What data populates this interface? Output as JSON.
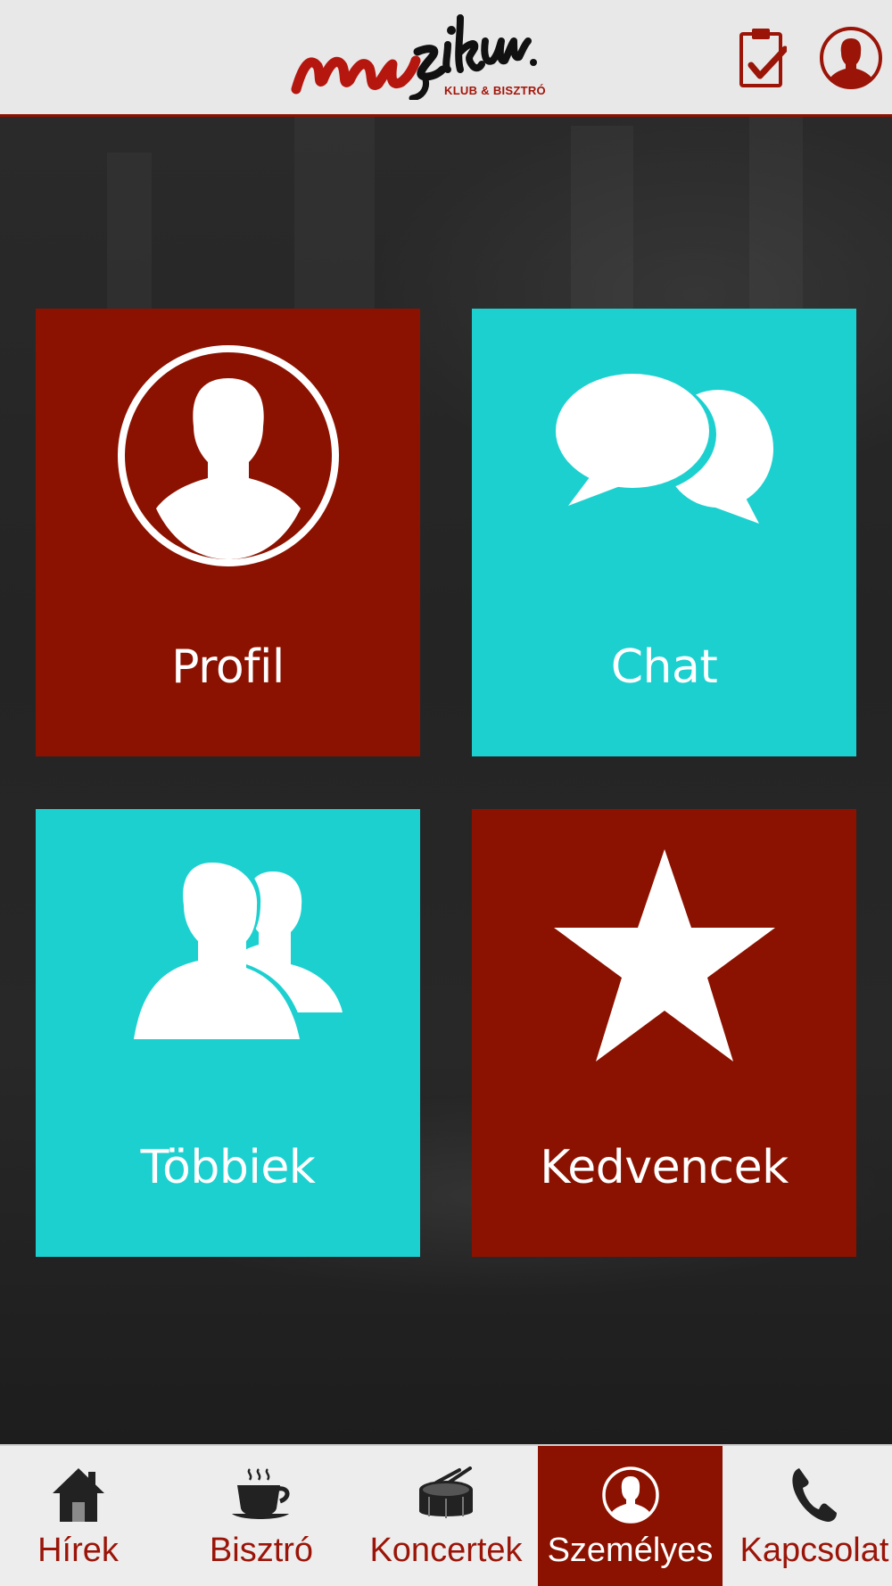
{
  "header": {
    "logo_text": "muzikum.",
    "logo_subtitle": "KLUB & BISZTRÓ",
    "checklist_icon": "clipboard-check-icon",
    "profile_icon": "user-circle-icon"
  },
  "tiles": [
    {
      "label": "Profil",
      "icon": "user-circle-icon",
      "color": "#8b1200"
    },
    {
      "label": "Chat",
      "icon": "chat-bubbles-icon",
      "color": "#1dd0d0"
    },
    {
      "label": "Többiek",
      "icon": "users-icon",
      "color": "#1dd0d0"
    },
    {
      "label": "Kedvencek",
      "icon": "star-icon",
      "color": "#8b1200"
    }
  ],
  "nav": {
    "items": [
      {
        "label": "Hírek",
        "icon": "home-icon",
        "active": false
      },
      {
        "label": "Bisztró",
        "icon": "coffee-cup-icon",
        "active": false
      },
      {
        "label": "Koncertek",
        "icon": "drum-icon",
        "active": false
      },
      {
        "label": "Személyes",
        "icon": "user-circle-icon",
        "active": true
      },
      {
        "label": "Kapcsolat",
        "icon": "phone-icon",
        "active": false
      }
    ]
  },
  "colors": {
    "brand_red": "#8b1200",
    "accent_cyan": "#1dd0d0",
    "header_bg": "#e8e8e8",
    "nav_bg": "#ededed"
  }
}
